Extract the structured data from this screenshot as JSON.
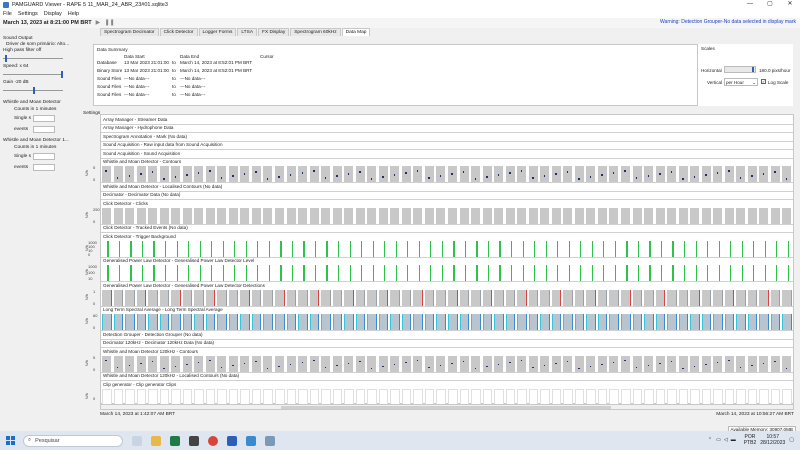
{
  "window": {
    "title": "PAMGUARD Viewer - RAPE 5 11_MAR_24_ABR_23#01.sqlite3",
    "controls": [
      "—",
      "▢",
      "✕"
    ]
  },
  "menu": [
    "File",
    "Settings",
    "Display",
    "Help"
  ],
  "datebar": {
    "date": "March 13, 2023 at 8:21:00 PM BRT"
  },
  "warning": "Warning: Detection Grouper-No data selected in display mark",
  "tabs": [
    "Spectrogram Decimator",
    "Click Detector",
    "Logger Forms",
    "LTSA",
    "FX Display",
    "Spectrogram 60kHz",
    "Data Map"
  ],
  "active_tab": "Data Map",
  "left_panel": {
    "sound_output": "Sound Output",
    "driver": "Driver de som primário: Alto...",
    "filter": "High pass filter off",
    "speed": "Speed: x 64",
    "gain": "Gain -20 dB",
    "wm1_title": "Whistle and Moan Detector",
    "wm1_counts": "Counts in 1 minutes",
    "wm1_single": "Single s",
    "wm1_events": "events",
    "wm2_title": "Whistle and Moan Detector 1...",
    "wm2_counts": "Counts in 1 minutes",
    "wm2_single": "Single s",
    "wm2_events": "events"
  },
  "summary": {
    "title": "Data Summary",
    "headers": {
      "start": "Data Start",
      "end": "Data End",
      "cursor": "Cursor"
    },
    "rows": [
      {
        "label": "Database",
        "start": "13 Mar 2023 21:01:00",
        "to": "to",
        "end": "March 14, 2023 at 8:52:01 PM BRT"
      },
      {
        "label": "Binary Store",
        "start": "13 Mar 2023 21:01:00",
        "to": "to",
        "end": "March 14, 2023 at 8:52:01 PM BRT"
      },
      {
        "label": "Sound Files",
        "start": "---No data---",
        "to": "to",
        "end": "---No data---"
      },
      {
        "label": "Sound Files",
        "start": "---No data---",
        "to": "to",
        "end": "---No data---"
      },
      {
        "label": "Sound Files",
        "start": "---No data---",
        "to": "to",
        "end": "---No data---"
      }
    ]
  },
  "scales": {
    "title": "Scales",
    "horizontal_label": "Horizontal",
    "horizontal_value": "180.0 pixs/hour",
    "vertical_label": "Vertical",
    "vertical_select": "per Hour",
    "log_scale": "Log Scale",
    "log_checked": true
  },
  "settings_label": "Settings",
  "rows": [
    {
      "label": "Array Manager - Streamer Data",
      "type": "plain"
    },
    {
      "label": "Array Manager - Hydrophone Data",
      "type": "plain"
    },
    {
      "label": "Spectrogram Annotation - Mark  (No data)",
      "type": "plain"
    },
    {
      "label": "Sound Acquisition - Raw input data from Sound Acquisition",
      "type": "plain"
    },
    {
      "label": "Sound Acquisition - Sound Acquisition",
      "type": "plain"
    },
    {
      "label": "Whistle and Moan Detector - Contours",
      "type": "strip",
      "style": "gray-dots",
      "yaxis": [
        "5",
        "0"
      ]
    },
    {
      "label": "Whistle and Moan Detector - Localised Contours  (No data)",
      "type": "plain"
    },
    {
      "label": "Decimator - Decimator Data  (No data)",
      "type": "plain"
    },
    {
      "label": "Click Detector - Clicks",
      "type": "strip",
      "style": "gray",
      "yaxis": [
        "250",
        "0"
      ]
    },
    {
      "label": "Click Detector - Tracked Events  (No data)",
      "type": "plain"
    },
    {
      "label": "Click Detector - Trigger Background",
      "type": "strip",
      "style": "green",
      "yaxis": [
        "1000",
        "100",
        "10",
        "0"
      ]
    },
    {
      "label": "Generalised Power Law Detector - Generalised Power Law Detector Level",
      "type": "strip",
      "style": "green",
      "yaxis": [
        "1000",
        "100",
        "10"
      ]
    },
    {
      "label": "Generalised Power Law Detector - Generalised Power Law Detector Detections",
      "type": "strip",
      "style": "red",
      "yaxis": [
        "1",
        "0"
      ]
    },
    {
      "label": "Long Term Spectral Average - Long Term Spectral Average",
      "type": "strip",
      "style": "blue",
      "yaxis": [
        "60",
        "0"
      ]
    },
    {
      "label": "Detection Grouper - Detection Grouper  (No data)",
      "type": "plain"
    },
    {
      "label": "Decimator 120kHz - Decimator 120kHz Data  (No data)",
      "type": "plain"
    },
    {
      "label": "Whistle and Moan Detector 120kHz - Contours",
      "type": "strip",
      "style": "gray-dots",
      "yaxis": [
        "5",
        "0"
      ]
    },
    {
      "label": "Whistle and Moan Detector 120kHz - Localised Contours  (No data)",
      "type": "plain"
    },
    {
      "label": "Clip generator - Clip generator Clips",
      "type": "strip",
      "style": "white",
      "yaxis": [
        "0"
      ]
    }
  ],
  "time_start": "March 14, 2023 at 1:42:07 AM BRT",
  "time_end": "March 14, 2023 at 10:56:27 AM BRT",
  "memory": "Available Memory: 30907.0MB",
  "taskbar": {
    "search": "Pesquisar",
    "lang1": "POR",
    "lang2": "PTB2",
    "time": "10:57",
    "date": "28/12/2023"
  },
  "colors": {
    "accent": "#2a5ec8",
    "warning": "#2040c0",
    "green": "#2fc24a",
    "red": "#e04040",
    "blue": "#3a8ad0",
    "cyan": "#30c8d8"
  }
}
